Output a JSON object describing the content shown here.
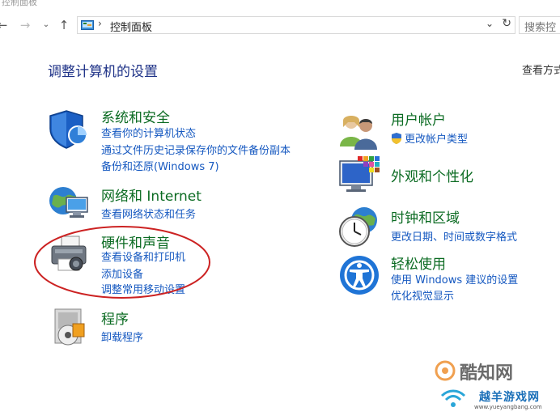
{
  "window": {
    "title": "控制面板"
  },
  "nav": {
    "address": "控制面板",
    "search_placeholder": "搜索控"
  },
  "main": {
    "heading": "调整计算机的设置",
    "view_by": "查看方式"
  },
  "categories": [
    {
      "title": "系统和安全",
      "links": [
        "查看你的计算机状态",
        "通过文件历史记录保存你的文件备份副本",
        "备份和还原(Windows 7)"
      ]
    },
    {
      "title": "网络和 Internet",
      "links": [
        "查看网络状态和任务"
      ]
    },
    {
      "title": "硬件和声音",
      "links": [
        "查看设备和打印机",
        "添加设备",
        "调整常用移动设置"
      ]
    },
    {
      "title": "程序",
      "links": [
        "卸载程序"
      ]
    },
    {
      "title": "用户帐户",
      "links": [
        "更改帐户类型"
      ]
    },
    {
      "title": "外观和个性化",
      "links": []
    },
    {
      "title": "时钟和区域",
      "links": [
        "更改日期、时间或数字格式"
      ]
    },
    {
      "title": "轻松使用",
      "links": [
        "使用 Windows 建议的设置",
        "优化视觉显示"
      ]
    }
  ],
  "watermark": {
    "brand1": "酷知网",
    "brand2": "越羊游戏网",
    "url": "www.yueyangbang.com"
  },
  "colors": {
    "heading": "#1e3287",
    "category": "#0b6b22",
    "link": "#1558c0",
    "annotation": "#cc2222"
  }
}
